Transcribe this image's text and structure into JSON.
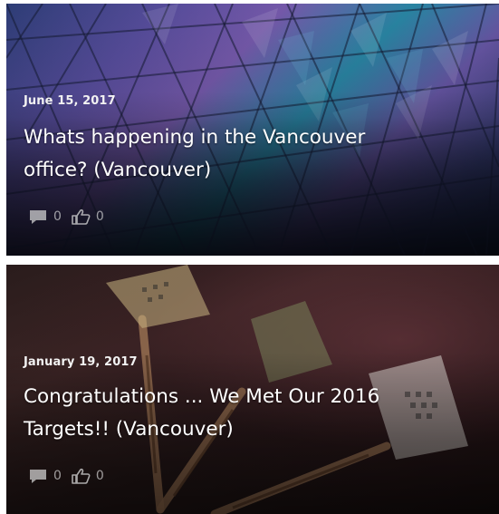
{
  "posts": [
    {
      "date": "June 15, 2017",
      "title_line1": "Whats happening in the Vancouver",
      "title_line2": "office? (Vancouver)",
      "comment_icon": "comment-icon",
      "like_icon": "thumbs-up-icon",
      "comments": "0",
      "likes": "0"
    },
    {
      "date": "January 19, 2017",
      "title_line1": "Congratulations ... We Met Our 2016",
      "title_line2": "Targets!! (Vancouver)",
      "comment_icon": "comment-icon",
      "like_icon": "thumbs-up-icon",
      "comments": "0",
      "likes": "0"
    }
  ]
}
